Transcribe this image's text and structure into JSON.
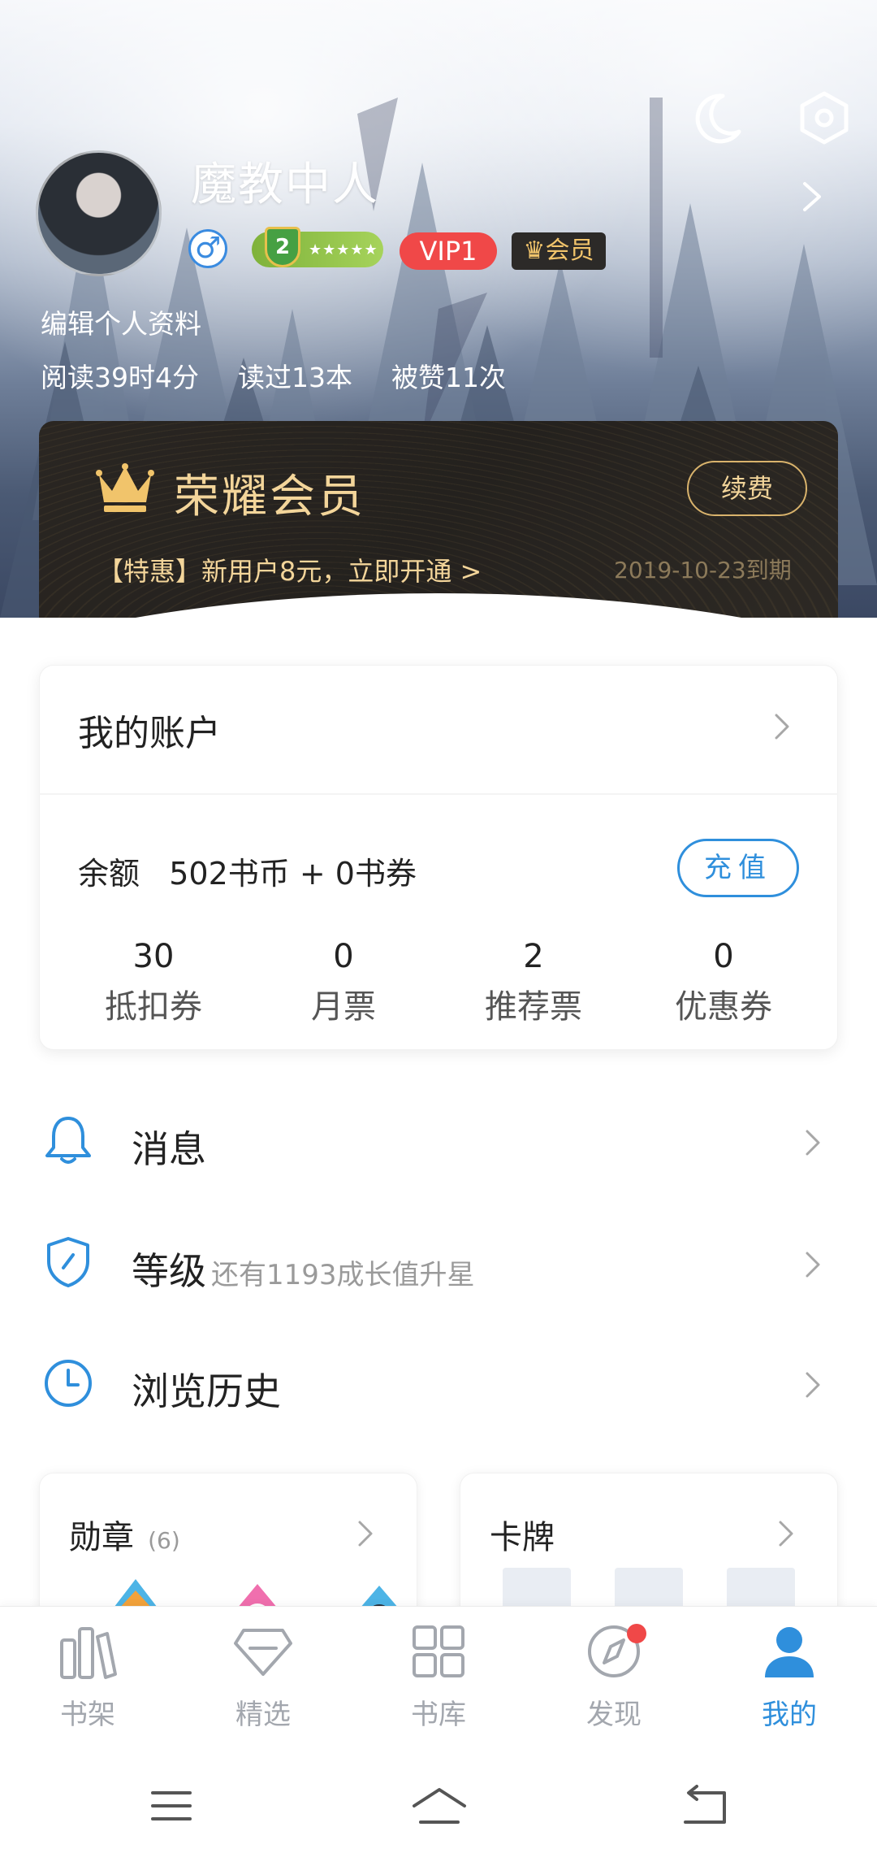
{
  "header": {
    "username": "魔教中人",
    "gender_symbol": "♂",
    "level_number": "2",
    "level_stars": "★★★★★",
    "vip_label": "VIP1",
    "member_label": "♛会员",
    "edit_profile": "编辑个人资料",
    "stats": {
      "reading_time": "阅读39时4分",
      "books_read": "读过13本",
      "likes": "被赞11次"
    },
    "icons": [
      "moon-icon",
      "settings-hexagon-icon",
      "chevron-right-icon"
    ]
  },
  "vip_card": {
    "title": "荣耀会员",
    "renew_label": "续费",
    "promo": "【特惠】新用户8元，立即开通 >",
    "expiry": "2019-10-23到期"
  },
  "account": {
    "title": "我的账户",
    "balance": "余额   502书币 + 0书券",
    "recharge_label": "充值",
    "tickets": [
      {
        "value": "30",
        "label": "抵扣券"
      },
      {
        "value": "0",
        "label": "月票"
      },
      {
        "value": "2",
        "label": "推荐票"
      },
      {
        "value": "0",
        "label": "优惠券"
      }
    ]
  },
  "menu": {
    "messages": {
      "label": "消息"
    },
    "level": {
      "label": "等级",
      "sub": "还有1193成长值升星"
    },
    "history": {
      "label": "浏览历史"
    }
  },
  "cards": {
    "medals": {
      "title": "勋章",
      "count": "(6)"
    },
    "cardbrand": {
      "title": "卡牌"
    }
  },
  "tabs": [
    {
      "label": "书架",
      "icon": "bookshelf-icon"
    },
    {
      "label": "精选",
      "icon": "diamond-icon"
    },
    {
      "label": "书库",
      "icon": "grid-icon"
    },
    {
      "label": "发现",
      "icon": "compass-icon"
    },
    {
      "label": "我的",
      "icon": "user-icon"
    }
  ],
  "colors": {
    "accent": "#2f8fdc",
    "vip_red": "#f04848",
    "gold": "#f3d59a",
    "card_dark": "#26221f"
  }
}
